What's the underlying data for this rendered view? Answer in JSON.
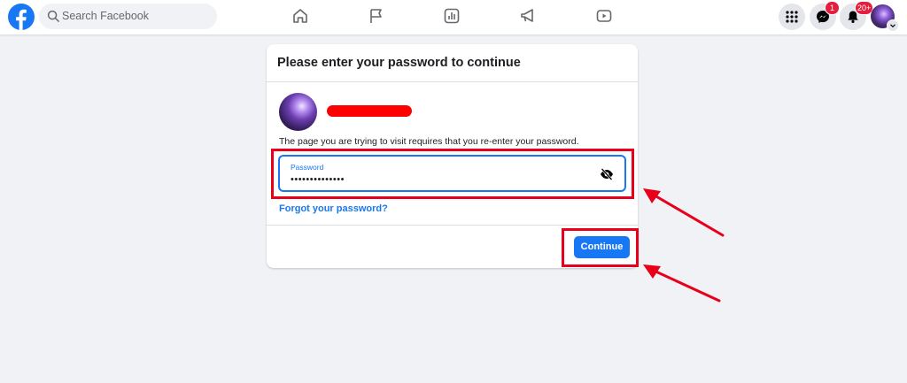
{
  "topbar": {
    "search_placeholder": "Search Facebook",
    "nav": [
      "home-icon",
      "flag-icon",
      "analytics-icon",
      "megaphone-icon",
      "video-icon"
    ],
    "messenger_badge": "1",
    "notifications_badge": "20+"
  },
  "dialog": {
    "title": "Please enter your password to continue",
    "message": "The page you are trying to visit requires that you re-enter your password.",
    "password_label": "Password",
    "password_value": "••••••••••••••",
    "forgot_link": "Forgot your password?",
    "continue_label": "Continue"
  },
  "colors": {
    "brand": "#1877f2",
    "highlight": "#e8001b",
    "redaction": "#ff0000",
    "background": "#f0f2f5"
  }
}
